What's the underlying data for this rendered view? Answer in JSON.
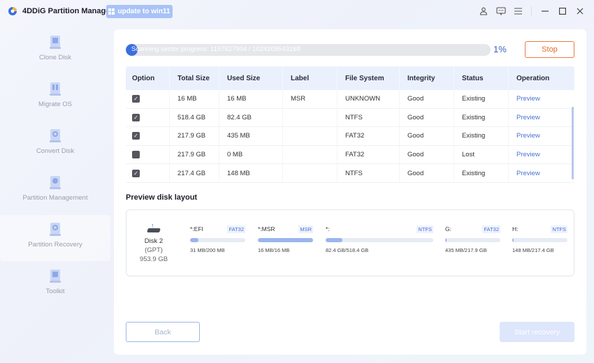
{
  "app": {
    "title": "4DDiG Partition Manager",
    "update_label": "update to win11",
    "toolbar_icons": [
      "user-icon",
      "feedback-icon",
      "menu-icon",
      "minimize-icon",
      "maximize-icon",
      "close-icon"
    ]
  },
  "sidebar": {
    "items": [
      {
        "label": "Clone Disk",
        "icon": "clone-disk-icon",
        "active": false
      },
      {
        "label": "Migrate OS",
        "icon": "migrate-os-icon",
        "active": false
      },
      {
        "label": "Convert Disk",
        "icon": "convert-disk-icon",
        "active": false
      },
      {
        "label": "Partition Management",
        "icon": "partition-management-icon",
        "active": false
      },
      {
        "label": "Partition Recovery",
        "icon": "partition-recovery-icon",
        "active": true
      },
      {
        "label": "Toolkit",
        "icon": "toolkit-icon",
        "active": false
      }
    ]
  },
  "scan": {
    "progress_text": "Scanning sector progress: 1157627904 / 1024209543168",
    "percent_label": "1%",
    "percent": 1,
    "stop_label": "Stop"
  },
  "table": {
    "columns": [
      "Option",
      "Total Size",
      "Used Size",
      "Label",
      "File System",
      "Integrity",
      "Status",
      "Operation"
    ],
    "rows": [
      {
        "checked": true,
        "total": "16 MB",
        "used": "16 MB",
        "label": "MSR",
        "fs": "UNKNOWN",
        "integrity": "Good",
        "status": "Existing",
        "operation": "Preview"
      },
      {
        "checked": true,
        "total": "518.4 GB",
        "used": "82.4 GB",
        "label": "",
        "fs": "NTFS",
        "integrity": "Good",
        "status": "Existing",
        "operation": "Preview"
      },
      {
        "checked": true,
        "total": "217.9 GB",
        "used": "435 MB",
        "label": "",
        "fs": "FAT32",
        "integrity": "Good",
        "status": "Existing",
        "operation": "Preview"
      },
      {
        "checked": false,
        "total": "217.9 GB",
        "used": "0 MB",
        "label": "",
        "fs": "FAT32",
        "integrity": "Good",
        "status": "Lost",
        "operation": "Preview"
      },
      {
        "checked": true,
        "total": "217.4 GB",
        "used": "148 MB",
        "label": "",
        "fs": "NTFS",
        "integrity": "Good",
        "status": "Existing",
        "operation": "Preview"
      }
    ]
  },
  "layout": {
    "title": "Preview disk layout",
    "disk": {
      "name": "Disk 2",
      "type": "(GPT)",
      "size": "953.9 GB"
    },
    "partitions": [
      {
        "name": "*:EFI",
        "fs": "FAT32",
        "usage": "31 MB/200 MB",
        "fill": 0.155
      },
      {
        "name": "*:MSR",
        "fs": "MSR",
        "usage": "16 MB/16 MB",
        "fill": 1.0
      },
      {
        "name": "*:",
        "fs": "NTFS",
        "usage": "82.4 GB/518.4 GB",
        "fill": 0.159
      },
      {
        "name": "G:",
        "fs": "FAT32",
        "usage": "435 MB/217.9 GB",
        "fill": 0.002
      },
      {
        "name": "H:",
        "fs": "NTFS",
        "usage": "148 MB/217.4 GB",
        "fill": 0.001
      }
    ]
  },
  "footer": {
    "back_label": "Back",
    "start_label": "Start recovery"
  }
}
